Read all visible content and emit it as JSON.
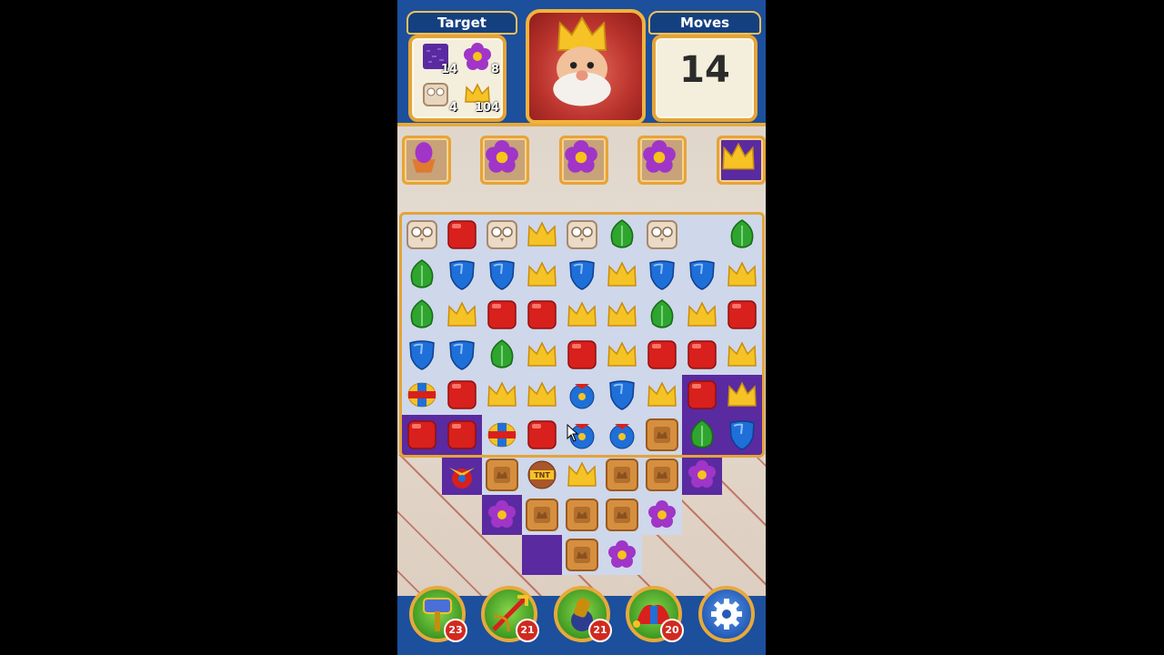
{
  "header": {
    "target_title": "Target",
    "moves_title": "Moves",
    "moves_value": "14",
    "targets": [
      {
        "icon": "purple-grass-icon",
        "count": "14"
      },
      {
        "icon": "purple-flower-icon",
        "count": "8"
      },
      {
        "icon": "stone-owl-icon",
        "count": "4"
      },
      {
        "icon": "crown-icon",
        "count": "104"
      }
    ],
    "avatar": "king-avatar-icon"
  },
  "shelf": [
    {
      "icon": "flower-pot-icon"
    },
    {
      "icon": "purple-flower-icon"
    },
    {
      "icon": "purple-flower-icon"
    },
    {
      "icon": "purple-flower-icon"
    },
    {
      "icon": "crown-icon"
    }
  ],
  "boosters": [
    {
      "icon": "hammer-icon",
      "count": "23"
    },
    {
      "icon": "arrow-icon",
      "count": "21"
    },
    {
      "icon": "cannon-icon",
      "count": "21"
    },
    {
      "icon": "jester-hat-icon",
      "count": "20"
    }
  ],
  "settings_icon": "gear-icon",
  "colors": {
    "header_blue": "#1c4f9c",
    "gold_border": "#e3a43a",
    "red": "#d8201c",
    "blue": "#1f6fd8",
    "green": "#2fa52f",
    "yellow": "#f5c325",
    "grass": "#5a2aa0"
  },
  "board": {
    "rows": [
      [
        "owl",
        "red",
        "owl",
        "crown",
        "owl",
        "leaf",
        "owl",
        "blank",
        "leaf"
      ],
      [
        "leaf",
        "shield",
        "shield",
        "crown",
        "shield",
        "crown",
        "shield",
        "shield",
        "crown"
      ],
      [
        "leaf",
        "crown",
        "red",
        "red",
        "crown",
        "crown",
        "leaf",
        "crown",
        "red"
      ],
      [
        "shield",
        "shield",
        "leaf",
        "crown",
        "red",
        "crown",
        "red",
        "red",
        "crown"
      ],
      [
        "rocket",
        "red",
        "crown",
        "crown",
        "bomb",
        "shield",
        "crown",
        "red",
        "crown"
      ],
      [
        "red",
        "red",
        "rocket",
        "red",
        "bomb",
        "bomb",
        "crate",
        "leaf",
        "shield"
      ],
      [
        "void",
        "propeller",
        "crate",
        "tnt",
        "crown",
        "crate",
        "crate",
        "flower",
        "void"
      ],
      [
        "void",
        "void",
        "flower",
        "crate",
        "crate",
        "crate",
        "flower",
        "void",
        "void"
      ],
      [
        "void",
        "void",
        "void",
        "grass",
        "crate",
        "flower",
        "void",
        "void",
        "void"
      ]
    ],
    "grass_cells": [
      [
        5,
        0
      ],
      [
        5,
        1
      ],
      [
        6,
        1
      ],
      [
        4,
        7
      ],
      [
        4,
        8
      ],
      [
        5,
        7
      ],
      [
        5,
        8
      ],
      [
        6,
        7
      ],
      [
        7,
        2
      ],
      [
        8,
        3
      ]
    ]
  }
}
